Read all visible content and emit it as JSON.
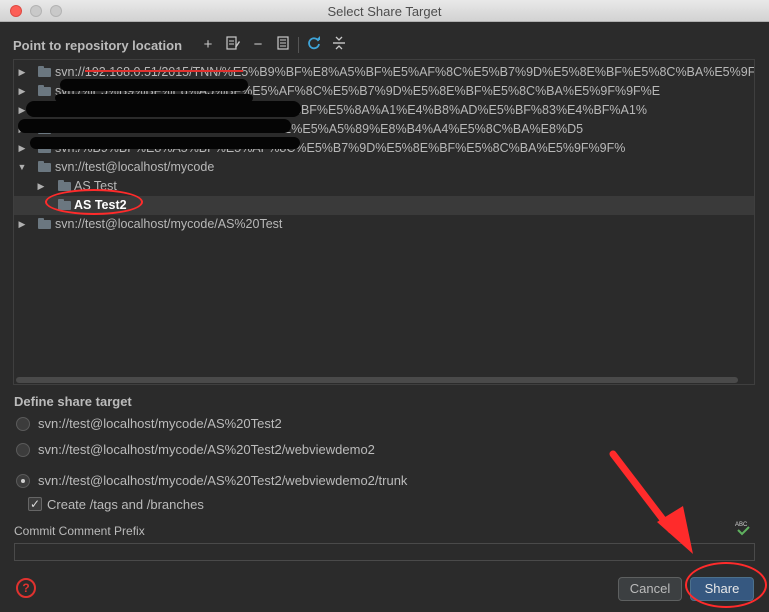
{
  "window": {
    "title": "Select Share Target"
  },
  "repo_section": {
    "label": "Point to repository location"
  },
  "toolbar": {
    "add_icon": "plus-icon",
    "edit_icon": "edit-icon",
    "remove_icon": "minus-icon",
    "browse_icon": "document-icon",
    "refresh_icon": "refresh-icon",
    "collapse_icon": "collapse-icon"
  },
  "tree": {
    "rows": [
      {
        "text": "svn://192.168.0.51/2015/TNN/%E5%B9%BF%E8%A5%BF%E5%AF%8C%E5%B7%9D%E5%8E%BF%E5%8C%BA%E5%9F%9F%E",
        "arrow": "collapsed"
      },
      {
        "text": "svn:/%E5%B9%BF%E8%A5%BF%E5%AF%8C%E5%B7%9D%E5%8E%BF%E5%8C%BA%E5%9F%9F%E",
        "arrow": "collapsed"
      },
      {
        "text": "svn:/%E5%8F%8C%E6%B5%81%E6%94%BF%E5%8A%A1%E4%B8%AD%E5%BF%83%E4%BF%A1%",
        "arrow": "collapsed"
      },
      {
        "text": "svn:/%B8%8A%E6%B5%B7%E5%B8%82%E5%A5%89%E8%B4%A4%E5%8C%BA%E8%D5",
        "arrow": "collapsed"
      },
      {
        "text": "svn:/%B9%BF%E8%A5%BF%E5%AF%8C%E5%B7%9D%E5%8E%BF%E5%8C%BA%E5%9F%9F%",
        "arrow": "collapsed"
      },
      {
        "text": "svn://test@localhost/mycode",
        "arrow": "expanded"
      },
      {
        "text": "AS Test",
        "arrow": "collapsed"
      },
      {
        "text": "AS Test2",
        "arrow": "none",
        "selected": true
      },
      {
        "text": "svn://test@localhost/mycode/AS%20Test",
        "arrow": "collapsed"
      }
    ]
  },
  "share_target": {
    "label": "Define share target",
    "options": [
      {
        "text": "svn://test@localhost/mycode/AS%20Test2",
        "checked": false
      },
      {
        "text": "svn://test@localhost/mycode/AS%20Test2/webviewdemo2",
        "checked": false
      },
      {
        "text": "svn://test@localhost/mycode/AS%20Test2/webviewdemo2/trunk",
        "checked": true
      }
    ],
    "create_tags_label": "Create /tags and /branches",
    "create_tags_checked": true
  },
  "commit": {
    "label": "Commit Comment Prefix",
    "value": "",
    "spellcheck_text": "ABC"
  },
  "footer": {
    "help_icon": "help-icon",
    "cancel_label": "Cancel",
    "share_label": "Share"
  },
  "colors": {
    "background": "#2b2b2b",
    "selection": "#3a3a3a",
    "annotation_red": "#ff2b2b",
    "share_button": "#365880"
  }
}
